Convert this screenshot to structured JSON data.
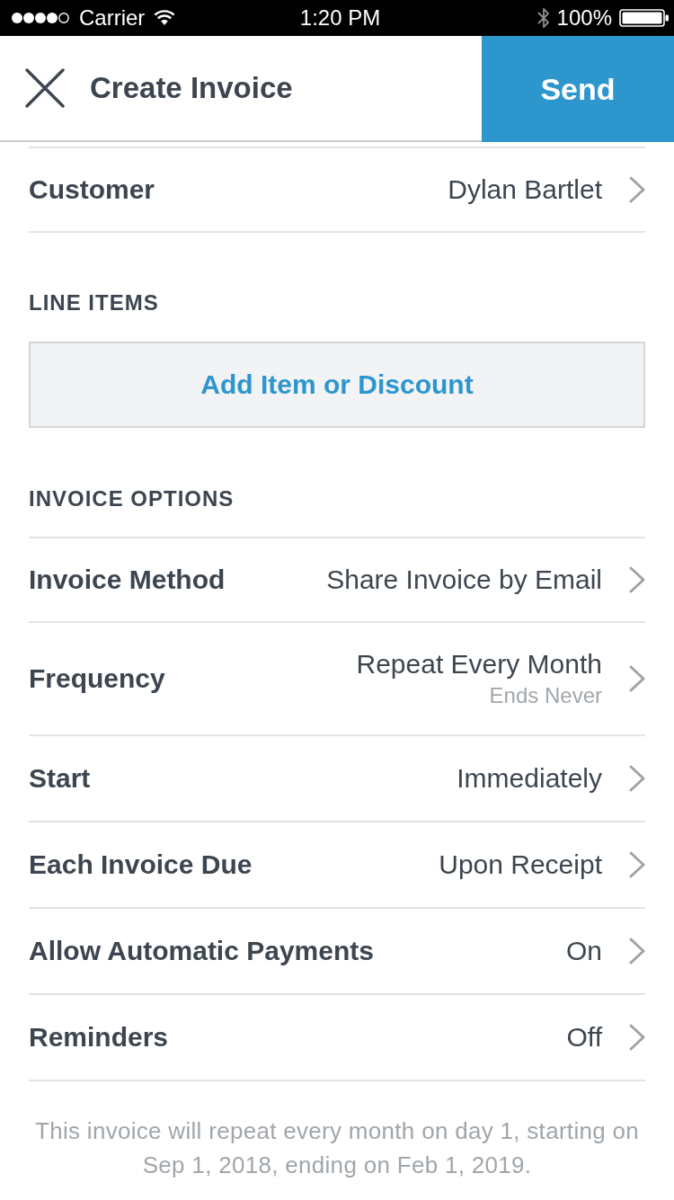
{
  "status_bar": {
    "carrier": "Carrier",
    "time": "1:20 PM",
    "battery": "100%"
  },
  "header": {
    "title": "Create Invoice",
    "send_button": "Send"
  },
  "customer": {
    "label": "Customer",
    "value": "Dylan Bartlet"
  },
  "line_items": {
    "heading": "LINE ITEMS",
    "add_button": "Add Item or Discount"
  },
  "invoice_options": {
    "heading": "INVOICE OPTIONS",
    "rows": [
      {
        "label": "Invoice Method",
        "value": "Share Invoice by Email"
      },
      {
        "label": "Frequency",
        "value": "Repeat Every Month",
        "subvalue": "Ends Never"
      },
      {
        "label": "Start",
        "value": "Immediately"
      },
      {
        "label": "Each Invoice Due",
        "value": "Upon Receipt"
      },
      {
        "label": "Allow Automatic Payments",
        "value": "On"
      },
      {
        "label": "Reminders",
        "value": "Off"
      }
    ]
  },
  "footer_note": "This invoice will repeat every month on day 1, starting on Sep 1, 2018, ending on Feb 1, 2019."
}
